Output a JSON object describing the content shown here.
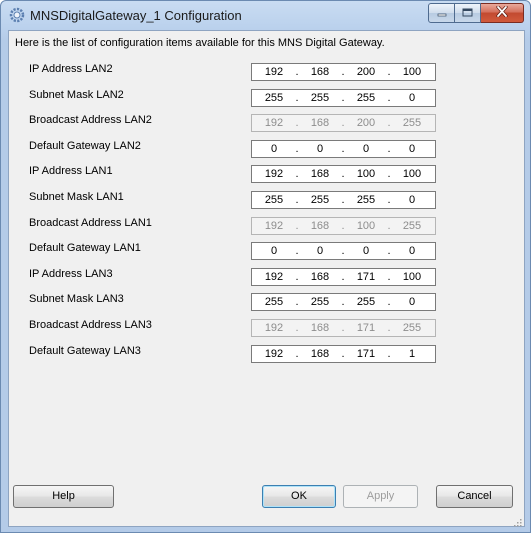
{
  "window": {
    "title": "MNSDigitalGateway_1 Configuration"
  },
  "intro": "Here is the list of configuration items available for this MNS Digital Gateway.",
  "fields": [
    {
      "label": "IP Address LAN2",
      "octets": [
        "192",
        "168",
        "200",
        "100"
      ],
      "enabled": true
    },
    {
      "label": "Subnet Mask LAN2",
      "octets": [
        "255",
        "255",
        "255",
        "0"
      ],
      "enabled": true
    },
    {
      "label": "Broadcast Address LAN2",
      "octets": [
        "192",
        "168",
        "200",
        "255"
      ],
      "enabled": false
    },
    {
      "label": "Default Gateway LAN2",
      "octets": [
        "0",
        "0",
        "0",
        "0"
      ],
      "enabled": true
    },
    {
      "label": "IP Address LAN1",
      "octets": [
        "192",
        "168",
        "100",
        "100"
      ],
      "enabled": true
    },
    {
      "label": "Subnet Mask LAN1",
      "octets": [
        "255",
        "255",
        "255",
        "0"
      ],
      "enabled": true
    },
    {
      "label": "Broadcast Address LAN1",
      "octets": [
        "192",
        "168",
        "100",
        "255"
      ],
      "enabled": false
    },
    {
      "label": "Default Gateway LAN1",
      "octets": [
        "0",
        "0",
        "0",
        "0"
      ],
      "enabled": true
    },
    {
      "label": "IP Address LAN3",
      "octets": [
        "192",
        "168",
        "171",
        "100"
      ],
      "enabled": true
    },
    {
      "label": "Subnet Mask LAN3",
      "octets": [
        "255",
        "255",
        "255",
        "0"
      ],
      "enabled": true
    },
    {
      "label": "Broadcast Address LAN3",
      "octets": [
        "192",
        "168",
        "171",
        "255"
      ],
      "enabled": false
    },
    {
      "label": "Default Gateway LAN3",
      "octets": [
        "192",
        "168",
        "171",
        "1"
      ],
      "enabled": true
    }
  ],
  "buttons": {
    "help": "Help",
    "ok": "OK",
    "apply": "Apply",
    "cancel": "Cancel"
  },
  "icons": {
    "app": "gear-icon",
    "minimize": "minimize-icon",
    "maximize": "maximize-icon",
    "close": "close-icon",
    "grip": "resize-grip-icon"
  },
  "colors": {
    "accent": "#3c7fb1",
    "close": "#c24a30",
    "titlebar": "#c9dcf2"
  }
}
